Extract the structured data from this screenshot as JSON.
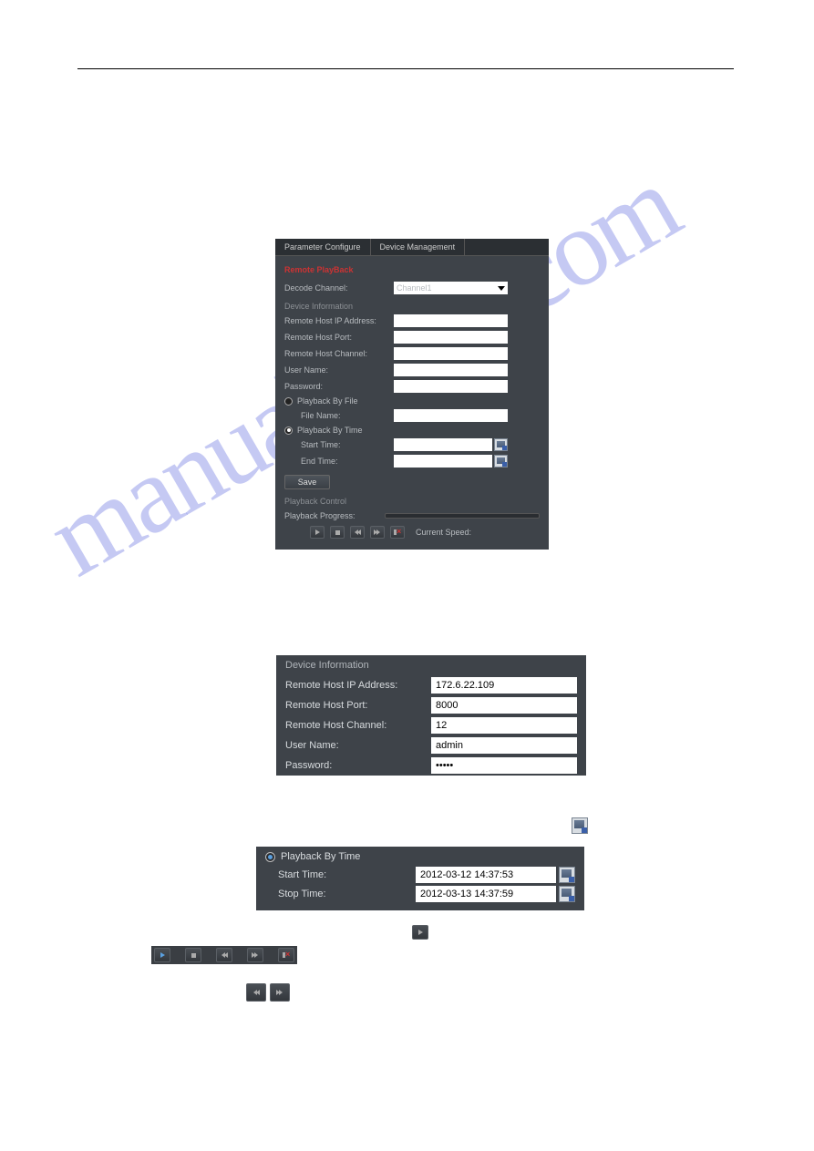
{
  "tabs": {
    "parameter": "Parameter Configure",
    "device": "Device Management"
  },
  "section": {
    "remotePlayback": "Remote PlayBack"
  },
  "decodeChannel": {
    "label": "Decode Channel:",
    "value": "Channel1"
  },
  "deviceInfoHead": "Device Information",
  "fields": {
    "ip": "Remote Host IP Address:",
    "port": "Remote Host Port:",
    "channel": "Remote Host Channel:",
    "user": "User Name:",
    "password": "Password:"
  },
  "playbackByFile": {
    "label": "Playback By File",
    "fileName": "File Name:"
  },
  "playbackByTime": {
    "label": "Playback By Time",
    "start": "Start Time:",
    "end": "End Time:"
  },
  "saveLabel": "Save",
  "playbackControlHead": "Playback Control",
  "playbackProgressLabel": "Playback Progress:",
  "currentSpeedLabel": "Current Speed:",
  "panel2": {
    "head": "Device Information",
    "ip": "Remote Host IP Address:",
    "ipVal": "172.6.22.109",
    "port": "Remote Host Port:",
    "portVal": "8000",
    "channel": "Remote Host Channel:",
    "channelVal": "12",
    "user": "User Name:",
    "userVal": "admin",
    "password": "Password:",
    "passwordVal": "•••••"
  },
  "panel3": {
    "title": "Playback By Time",
    "start": "Start Time:",
    "startVal": "2012-03-12 14:37:53",
    "stop": "Stop Time:",
    "stopVal": "2012-03-13 14:37:59"
  }
}
